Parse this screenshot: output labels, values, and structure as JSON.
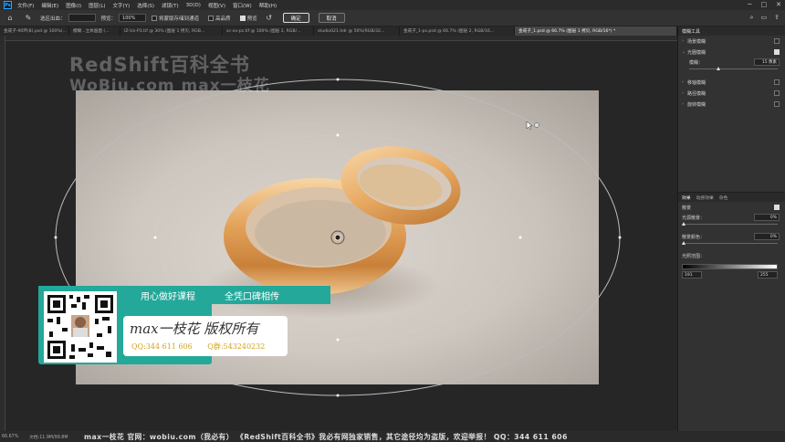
{
  "menubar": {
    "logo": "Ps",
    "items": [
      "文件(F)",
      "编辑(E)",
      "图像(I)",
      "图层(L)",
      "文字(Y)",
      "选择(S)",
      "滤镜(T)",
      "3D(D)",
      "视图(V)",
      "窗口(W)",
      "帮助(H)"
    ]
  },
  "options": {
    "preset_label": "选区出血：",
    "preset_value": "",
    "feather_label": "预览：",
    "feather_value": "100%",
    "save_mask_label": "将蒙版存储到通道",
    "hq_label": "高品质",
    "preview_label": "预览",
    "ok_label": "确定",
    "cancel_label": "取消"
  },
  "tabs": [
    {
      "label": "金戒子-90环(8).psd @ 100%(...",
      "active": false
    },
    {
      "label": "模糊...立体画面 (...",
      "active": false
    },
    {
      "label": "IZ-Un-P3.tif @ 30% (图层 1 拷贝, RGB...",
      "active": false
    },
    {
      "label": "sc-ov-ps.tif @ 100% (图层 2, RGB/...",
      "active": false
    },
    {
      "label": "studio021.hdr @ 50%(RGB/32...",
      "active": false
    },
    {
      "label": "金戒子_1-ps.psd @ 66.7% (图层 2, RGB/16...",
      "active": false
    },
    {
      "label": "金戒子_1.psd @ 66.7% (图层 1 拷贝, RGB/16*) *",
      "active": true
    }
  ],
  "watermark": {
    "line1": "RedShift百科全书",
    "line2": "WoBiu.com  max一枝花"
  },
  "promo": {
    "slogan1": "用心做好课程",
    "slogan2": "全凭口碑相传",
    "name": "max一枝花  版权所有",
    "qq": "QQ:344 611 606",
    "qgroup": "Q群:543240232"
  },
  "panel": {
    "header": "模糊工具",
    "items": [
      {
        "label": "场景模糊",
        "expanded": false,
        "checked": false
      },
      {
        "label": "光圈模糊",
        "expanded": true,
        "checked": true
      },
      {
        "label": "移轴模糊",
        "expanded": false,
        "checked": false
      },
      {
        "label": "路径模糊",
        "expanded": false,
        "checked": false
      },
      {
        "label": "旋转模糊",
        "expanded": false,
        "checked": false
      }
    ],
    "blur_label": "模糊：",
    "blur_value": "15 像素",
    "effects_tabs": [
      "效果",
      "动感效果",
      "杂色"
    ],
    "bokeh_label": "散景",
    "light_bokeh_label": "光源散景：",
    "light_bokeh_value": "0%",
    "bokeh_color_label": "散景颜色：",
    "bokeh_color_value": "0%",
    "light_range_label": "光照范围：",
    "range_low": "191",
    "range_high": "255"
  },
  "status": {
    "zoom": "66.67%",
    "doc": "文档:11.9M/99.8M",
    "banner": "max一枝花 官网：wobiu.com（我必有） 《RedShift百科全书》我必有网独家销售，其它途径均为盗版，欢迎举报！ QQ：344 611 606"
  },
  "colors": {
    "accent_teal": "#23a89a",
    "contact_gold": "#d4a318",
    "gold_ring": "#e6a55c"
  }
}
